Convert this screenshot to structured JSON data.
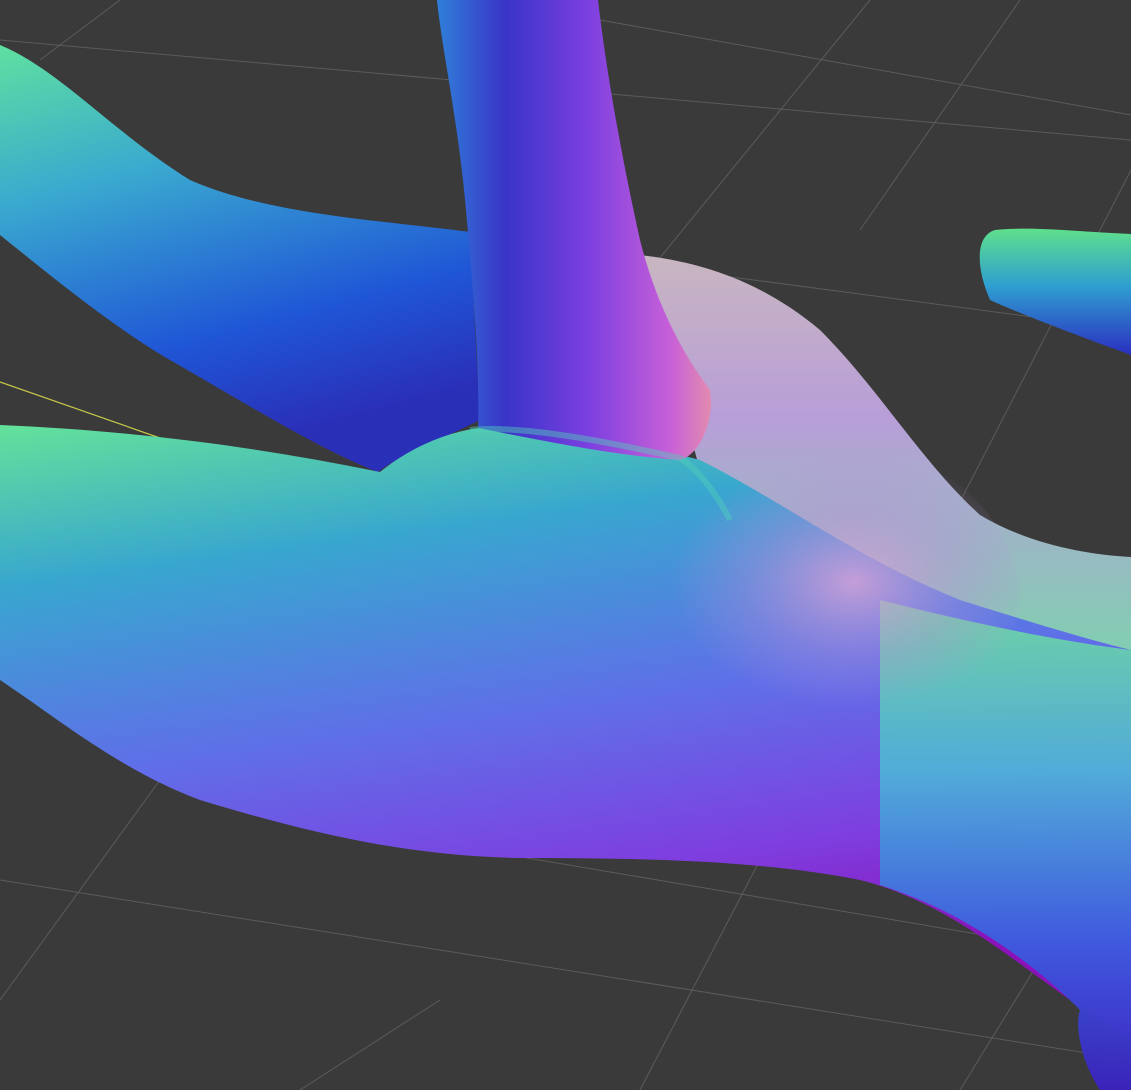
{
  "viewport": {
    "background_color": "#3a3a3a",
    "grid_color": "#5b5b5b",
    "axis_line_color": "#c9c84a",
    "shading": "normal-map",
    "mesh_palette": [
      "#1f3fc8",
      "#2e6fdd",
      "#3aa6d0",
      "#5fe08c",
      "#7b3fe0",
      "#9b2fd0",
      "#d86bd0",
      "#b4a0d8"
    ]
  }
}
